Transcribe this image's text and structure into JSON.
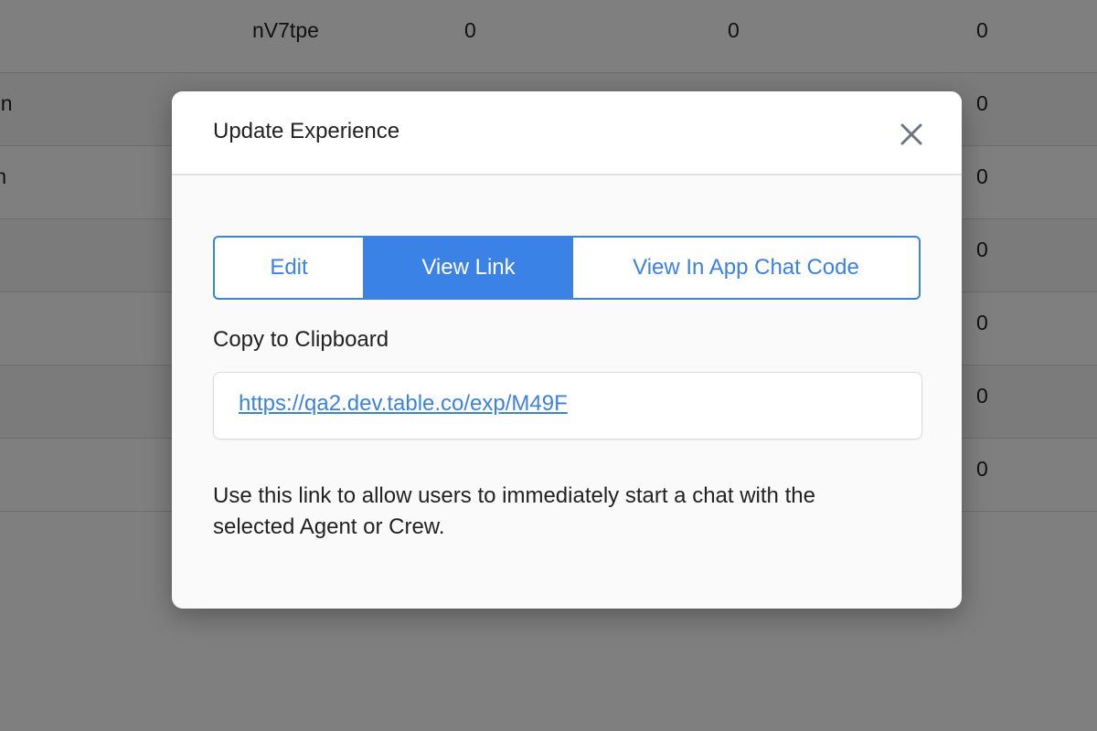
{
  "background_table": {
    "rows": [
      {
        "name": "",
        "code": "nV7tpe",
        "c1": "0",
        "c2": "0",
        "c3": "0"
      },
      {
        "name": "gn",
        "code": "",
        "c1": "",
        "c2": "",
        "c3": "0"
      },
      {
        "name": "m",
        "code": "",
        "c1": "",
        "c2": "",
        "c3": "0"
      },
      {
        "name": "",
        "code": "",
        "c1": "",
        "c2": "",
        "c3": "0"
      },
      {
        "name": "",
        "code": "",
        "c1": "",
        "c2": "",
        "c3": "0"
      },
      {
        "name": "",
        "code": "",
        "c1": "",
        "c2": "",
        "c3": "0"
      },
      {
        "name": "",
        "code": "",
        "c1": "",
        "c2": "",
        "c3": "0"
      }
    ]
  },
  "modal": {
    "title": "Update Experience",
    "close_icon": "close-icon",
    "tabs": [
      {
        "label": "Edit",
        "active": false
      },
      {
        "label": "View Link",
        "active": true
      },
      {
        "label": "View In App Chat Code",
        "active": false
      }
    ],
    "section_label": "Copy to Clipboard",
    "link_url": "https://qa2.dev.table.co/exp/M49F",
    "help_text": "Use this link to allow users to immediately start a chat with the selected Agent or Crew."
  },
  "colors": {
    "accent": "#3b82e6",
    "overlay": "rgba(0,0,0,0.5)"
  }
}
